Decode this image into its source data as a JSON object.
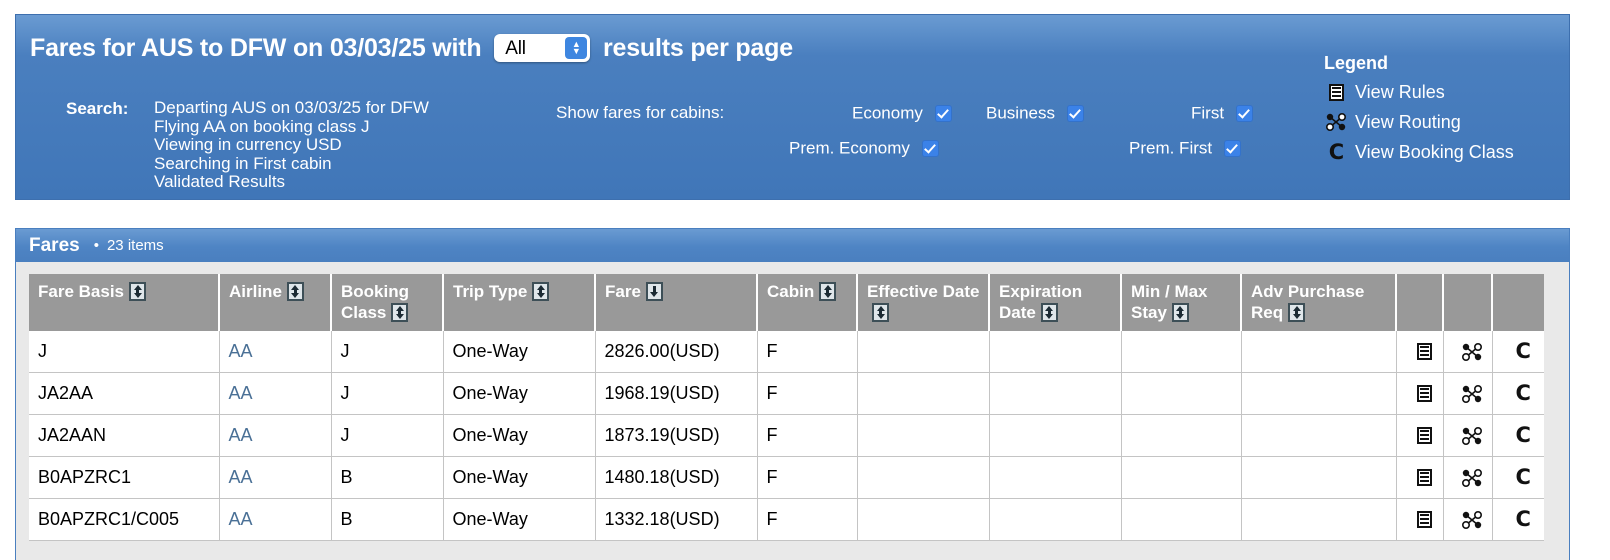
{
  "header": {
    "title_prefix": "Fares for AUS to DFW on 03/03/25 with",
    "title_suffix": "results per page",
    "per_page_value": "All",
    "per_page_options": [
      "All"
    ],
    "search_label": "Search:",
    "search_lines": [
      "Departing AUS on 03/03/25 for DFW",
      "Flying AA on booking class J",
      "Viewing in currency USD",
      "Searching in First cabin",
      "Validated Results"
    ],
    "cabins_label": "Show fares for cabins:",
    "cabins": [
      {
        "label": "Economy",
        "checked": true
      },
      {
        "label": "Business",
        "checked": true
      },
      {
        "label": "First",
        "checked": true
      },
      {
        "label": "Prem. Economy",
        "checked": true
      },
      {
        "label": "Prem. First",
        "checked": true
      }
    ],
    "legend": {
      "title": "Legend",
      "items": [
        {
          "icon": "view-rules-icon",
          "label": "View Rules"
        },
        {
          "icon": "view-routing-icon",
          "label": "View Routing"
        },
        {
          "icon": "view-booking-class-icon",
          "label": "View Booking Class"
        }
      ]
    }
  },
  "results": {
    "title": "Fares",
    "separator": "•",
    "count_label": "23 items",
    "columns": [
      {
        "label": "Fare Basis",
        "sort": "both"
      },
      {
        "label": "Airline",
        "sort": "both"
      },
      {
        "label": "Booking Class",
        "sort": "both"
      },
      {
        "label": "Trip Type",
        "sort": "both"
      },
      {
        "label": "Fare",
        "sort": "desc"
      },
      {
        "label": "Cabin",
        "sort": "both"
      },
      {
        "label": "Effective Date",
        "sort": "both"
      },
      {
        "label": "Expiration Date",
        "sort": "both"
      },
      {
        "label": "Min / Max Stay",
        "sort": "both"
      },
      {
        "label": "Adv Purchase Req",
        "sort": "both"
      },
      {
        "label": "",
        "sort": "none"
      },
      {
        "label": "",
        "sort": "none"
      },
      {
        "label": "",
        "sort": "none"
      }
    ],
    "rows": [
      {
        "fare_basis": "J",
        "airline": "AA",
        "booking_class": "J",
        "trip_type": "One-Way",
        "fare": "2826.00(USD)",
        "cabin": "F",
        "effective_date": "",
        "expiration_date": "",
        "min_max_stay": "",
        "adv_purchase_req": ""
      },
      {
        "fare_basis": "JA2AA",
        "airline": "AA",
        "booking_class": "J",
        "trip_type": "One-Way",
        "fare": "1968.19(USD)",
        "cabin": "F",
        "effective_date": "",
        "expiration_date": "",
        "min_max_stay": "",
        "adv_purchase_req": ""
      },
      {
        "fare_basis": "JA2AAN",
        "airline": "AA",
        "booking_class": "J",
        "trip_type": "One-Way",
        "fare": "1873.19(USD)",
        "cabin": "F",
        "effective_date": "",
        "expiration_date": "",
        "min_max_stay": "",
        "adv_purchase_req": ""
      },
      {
        "fare_basis": "B0APZRC1",
        "airline": "AA",
        "booking_class": "B",
        "trip_type": "One-Way",
        "fare": "1480.18(USD)",
        "cabin": "F",
        "effective_date": "",
        "expiration_date": "",
        "min_max_stay": "",
        "adv_purchase_req": ""
      },
      {
        "fare_basis": "B0APZRC1/C005",
        "airline": "AA",
        "booking_class": "B",
        "trip_type": "One-Way",
        "fare": "1332.18(USD)",
        "cabin": "F",
        "effective_date": "",
        "expiration_date": "",
        "min_max_stay": "",
        "adv_purchase_req": ""
      }
    ],
    "row_action_icons": [
      "view-rules-icon",
      "view-routing-icon",
      "view-booking-class-icon"
    ],
    "booking_class_glyph": "C"
  },
  "colors": {
    "panel_blue": "#4a7fbf",
    "panel_blue_light": "#6a9bd2",
    "header_gray": "#999999",
    "link_blue": "#4a7096",
    "checkbox_blue": "#3b82e8"
  }
}
